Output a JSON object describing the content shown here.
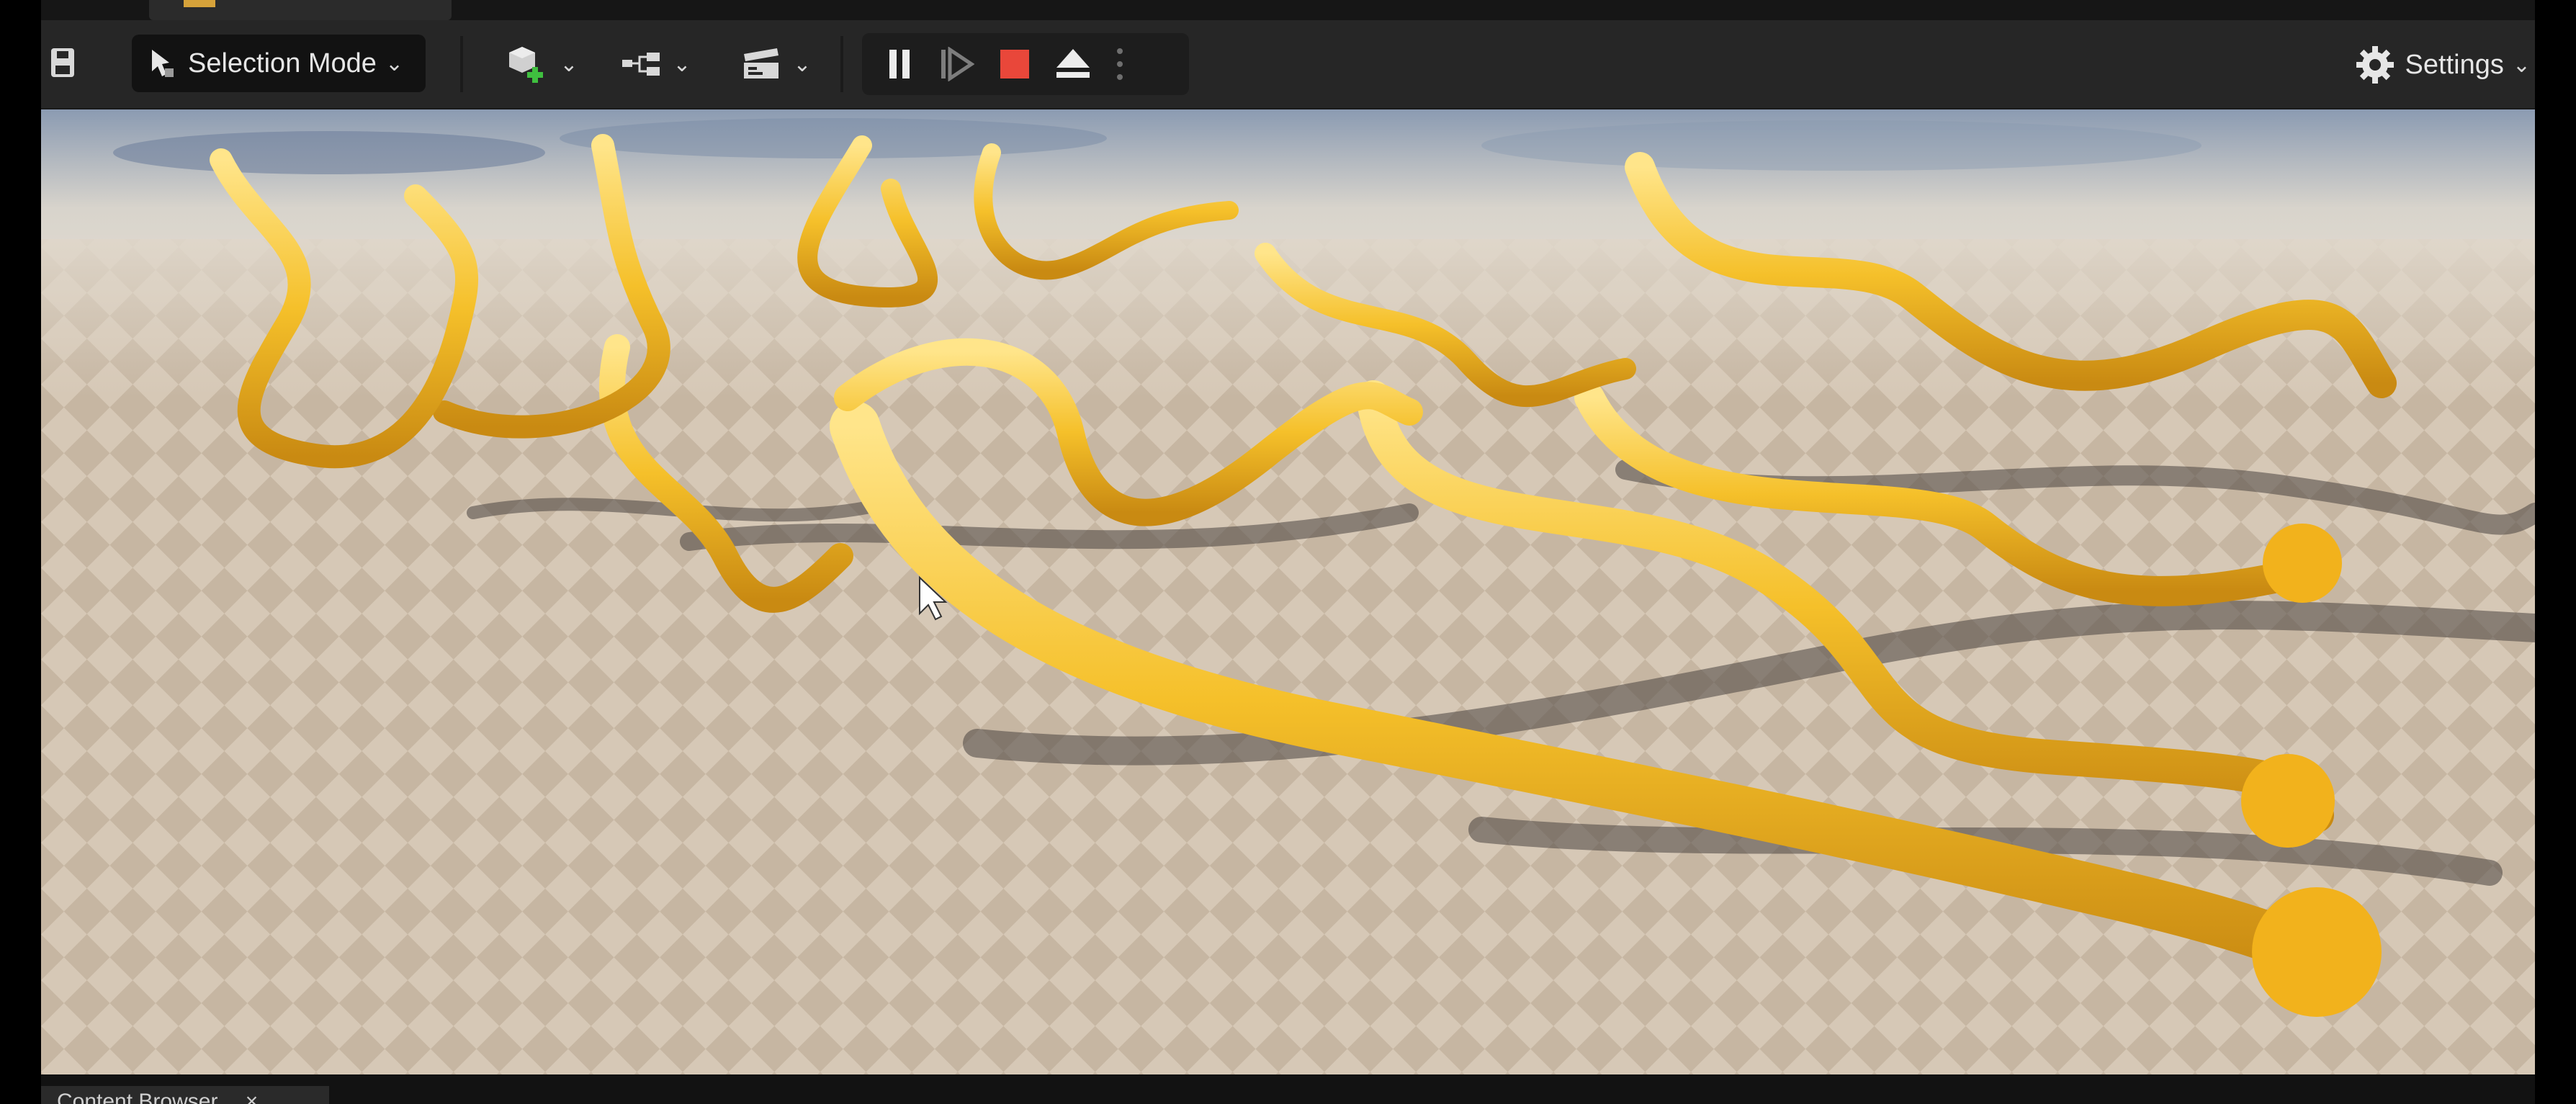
{
  "toolbar": {
    "selection_mode_label": "Selection Mode",
    "settings_label": "Settings",
    "icons": {
      "save": "save-icon",
      "selection_mode": "select-arrow-icon",
      "add_actor": "add-actor-icon",
      "blueprints": "blueprint-graph-icon",
      "cinematics": "clapperboard-icon",
      "pause": "pause-icon",
      "step": "frame-advance-icon",
      "stop": "stop-icon",
      "eject": "eject-icon",
      "more": "vertical-dots-icon",
      "settings": "gear-icon"
    }
  },
  "viewport": {
    "scene": "golden dragon meshes over checkered ground plane"
  },
  "bottom_panel": {
    "tab_label": "Content Browser"
  },
  "colors": {
    "toolbar_bg": "#262626",
    "stop_red": "#e9473a",
    "dragon_gold": "#f5c02a",
    "floor_light": "#d8cbba",
    "floor_dark": "#c4b4a0"
  }
}
